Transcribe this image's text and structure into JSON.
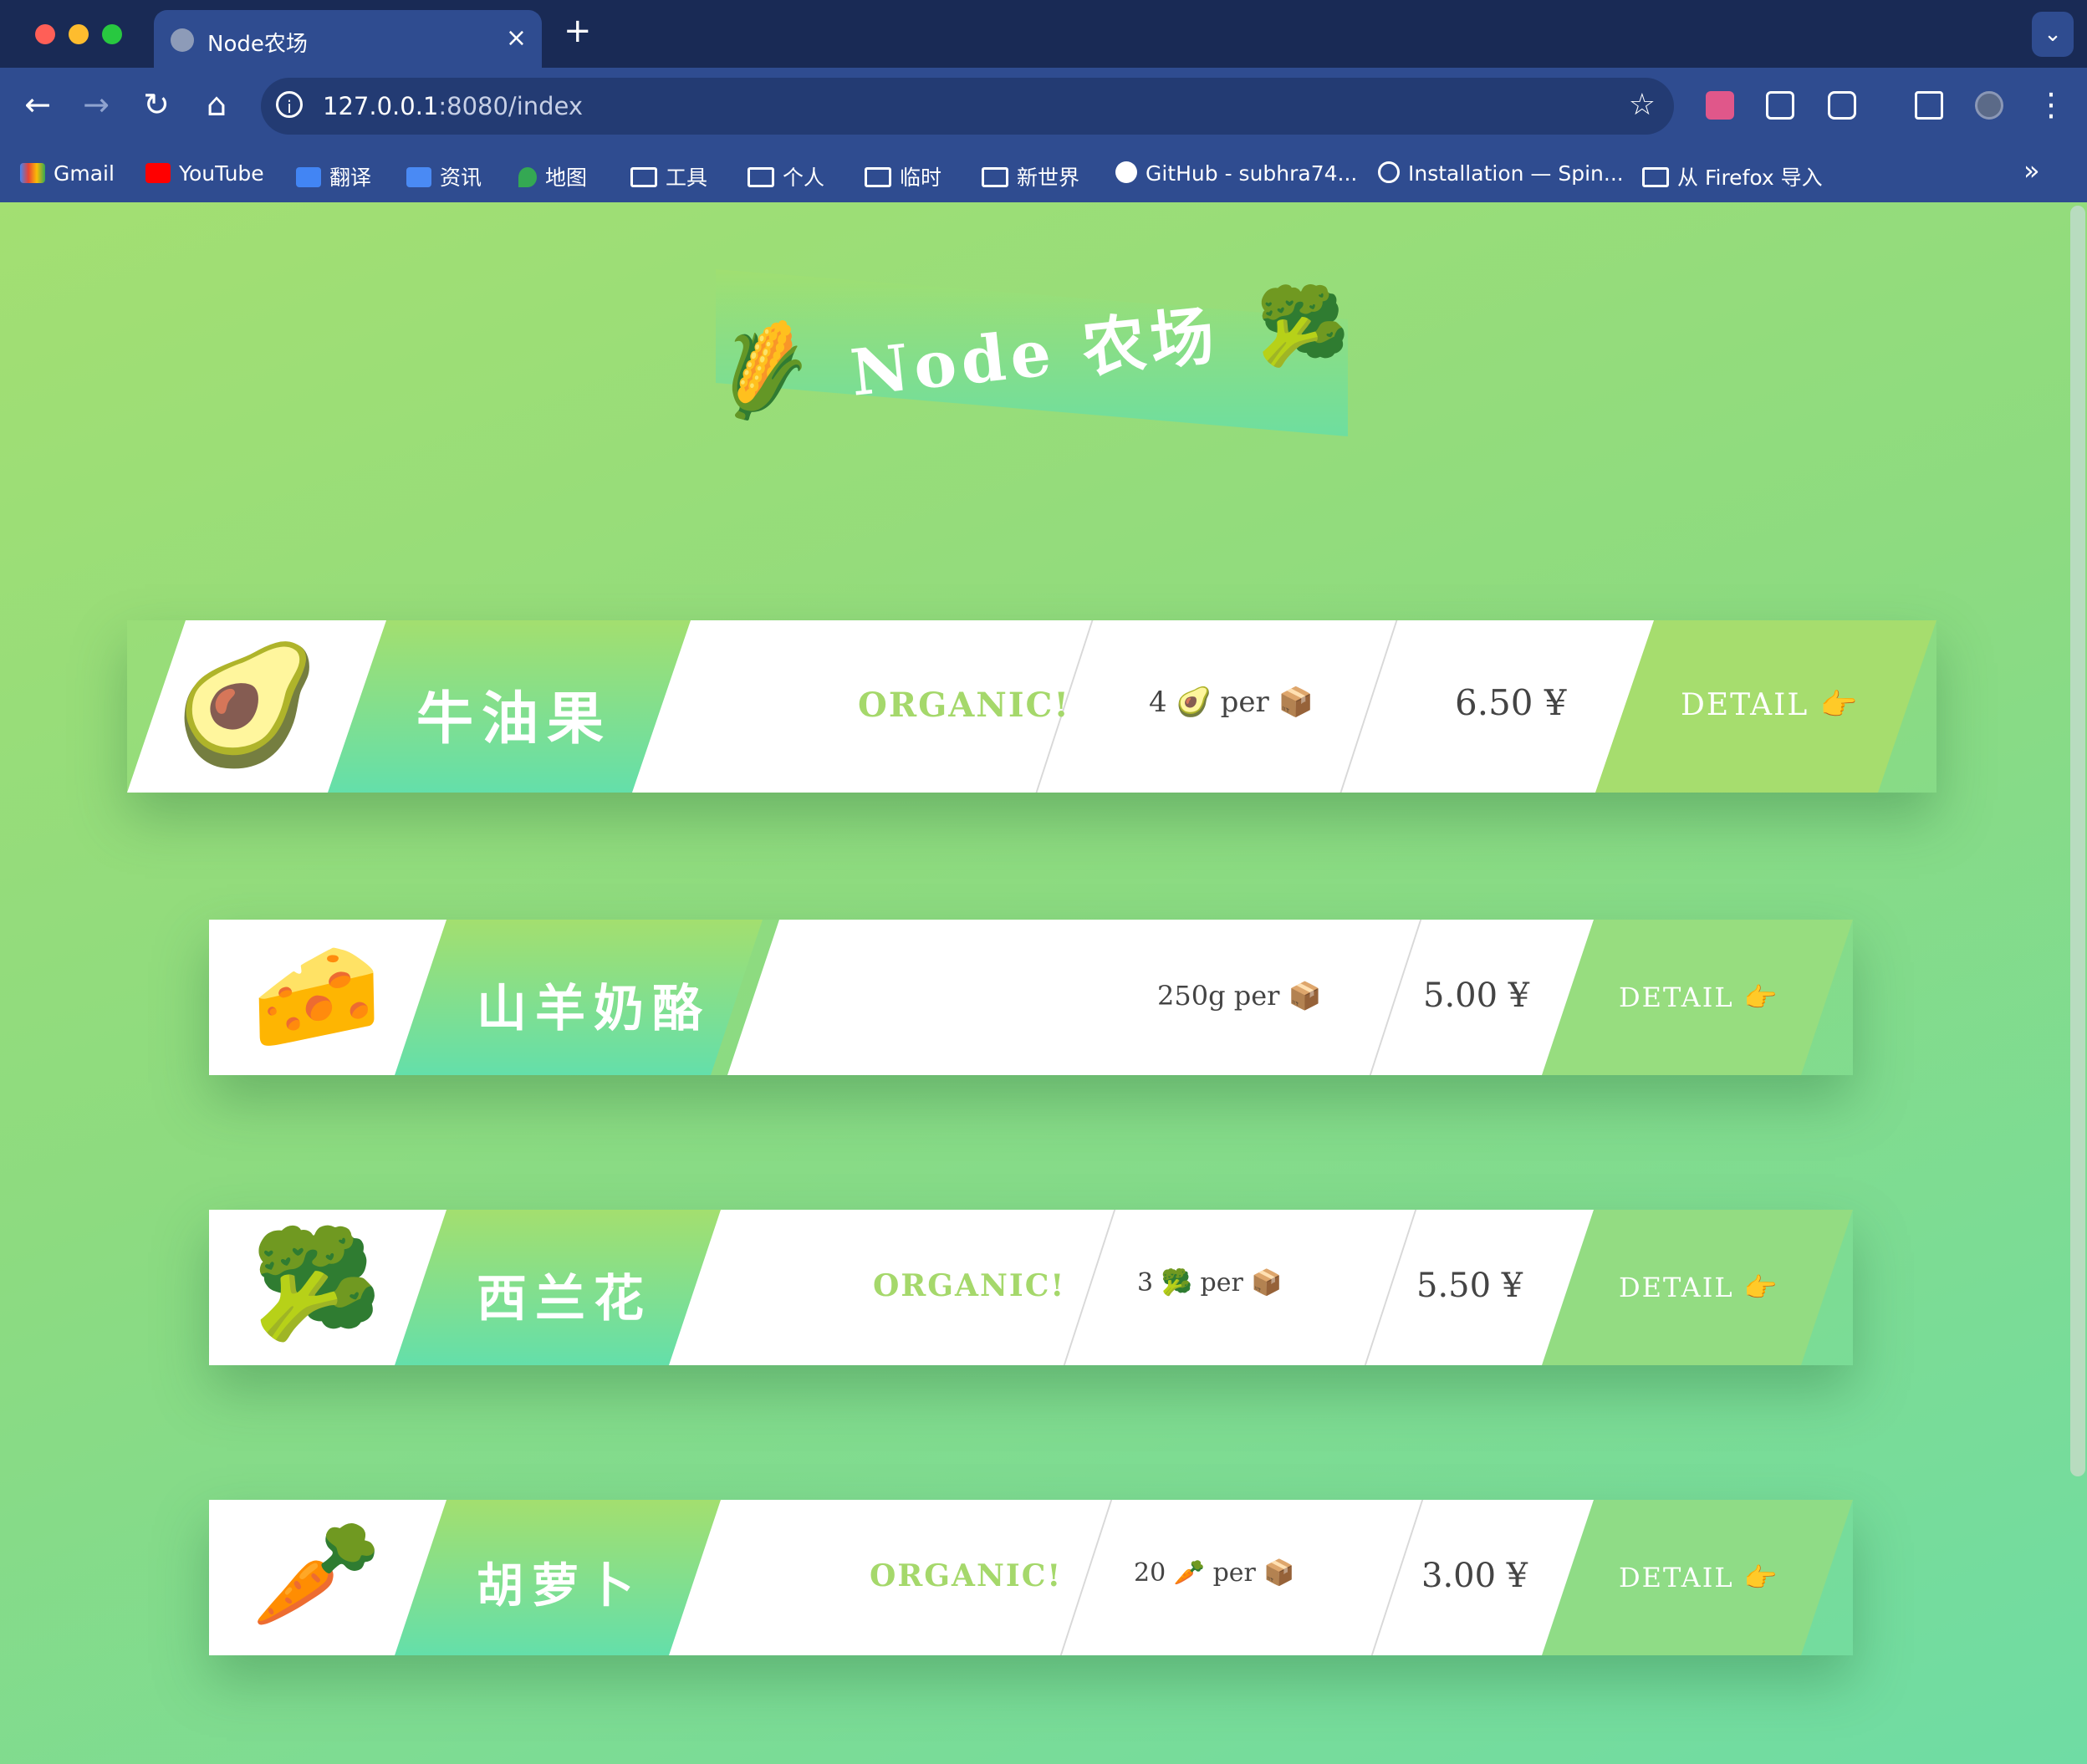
{
  "browser": {
    "tab_title": "Node农场",
    "tab_close": "×",
    "new_tab": "+",
    "url_host": "127.0.0.1",
    "url_rest": ":8080/index",
    "bookmarks": [
      "Gmail",
      "YouTube",
      "翻译",
      "资讯",
      "地图",
      "工具",
      "个人",
      "临时",
      "新世界",
      "GitHub - subhra74...",
      "Installation — Spin...",
      "从 Firefox 导入"
    ],
    "more_bookmarks": "»",
    "icons": [
      "back-icon",
      "forward-icon",
      "reload-icon",
      "home-icon",
      "info-icon",
      "star-icon",
      "extensions-icon",
      "side-panel-icon",
      "profile-avatar",
      "menu-icon"
    ]
  },
  "page": {
    "title": "Node 农场",
    "title_emoji_left": "🌽",
    "title_emoji_right": "🥦",
    "products": [
      {
        "emoji": "🥑",
        "name": "牛油果",
        "organic": "ORGANIC!",
        "quantity": "4 🥑 per 📦",
        "price": "6.50 ¥",
        "detail": "DETAIL 👉"
      },
      {
        "emoji": "🧀",
        "name": "山羊奶酪",
        "organic": "",
        "quantity": "250g per 📦",
        "price": "5.00 ¥",
        "detail": "DETAIL 👉"
      },
      {
        "emoji": "🥦",
        "name": "西兰花",
        "organic": "ORGANIC!",
        "quantity": "3 🥦 per 📦",
        "price": "5.50 ¥",
        "detail": "DETAIL 👉"
      },
      {
        "emoji": "🥕",
        "name": "胡萝卜",
        "organic": "ORGANIC!",
        "quantity": "20 🥕 per 📦",
        "price": "3.00 ¥",
        "detail": "DETAIL 👉"
      }
    ]
  },
  "colors": {
    "page_gradient_start": "#a3df72",
    "page_gradient_end": "#6fdca4",
    "organic": "#a5d86b",
    "detail_background": "#a6dd6e",
    "chrome_background": "#2f4c90"
  }
}
